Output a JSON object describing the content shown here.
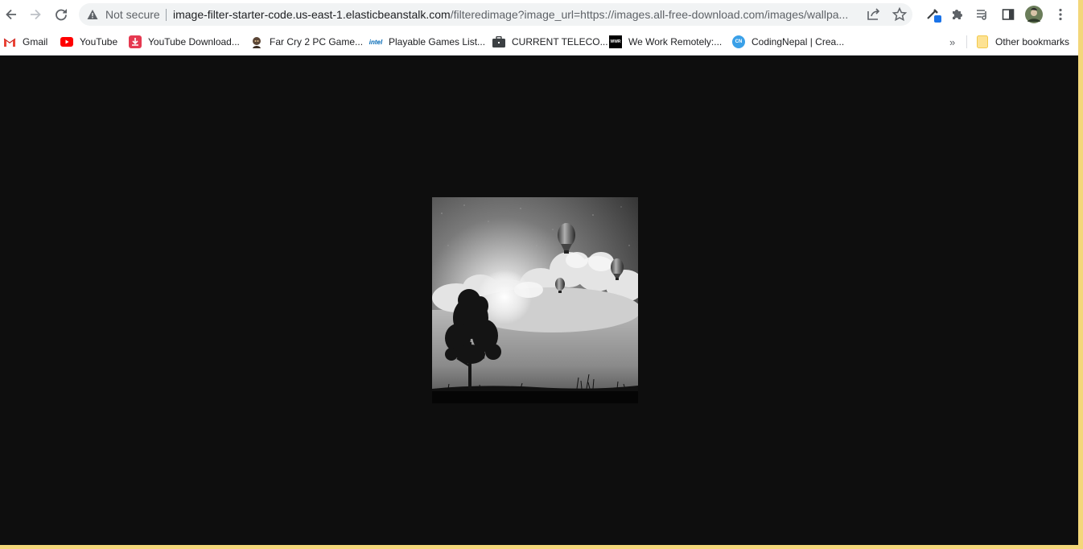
{
  "browser": {
    "security_label": "Not secure",
    "url_host": "image-filter-starter-code.us-east-1.elasticbeanstalk.com",
    "url_rest": "/filteredimage?image_url=https://images.all-free-download.com/images/wallpa...",
    "icons": {
      "back": "arrow-left-icon",
      "forward": "arrow-right-icon",
      "reload": "reload-icon",
      "warning": "warning-triangle-icon",
      "share": "share-icon",
      "bookmark": "star-icon",
      "eyedropper": "eyedropper-icon",
      "extensions": "puzzle-icon",
      "reading_list": "reading-list-icon",
      "side_panel": "side-panel-icon",
      "profile": "avatar",
      "menu": "kebab-menu-icon"
    }
  },
  "bookmarks": {
    "items": [
      {
        "label": "Gmail",
        "icon": "gmail-icon"
      },
      {
        "label": "YouTube",
        "icon": "youtube-icon"
      },
      {
        "label": "YouTube Download...",
        "icon": "download-icon"
      },
      {
        "label": "Far Cry 2 PC Game...",
        "icon": "game-icon"
      },
      {
        "label": "Playable Games List...",
        "icon": "intel-icon"
      },
      {
        "label": "CURRENT TELECO...",
        "icon": "briefcase-icon"
      },
      {
        "label": "We Work Remotely:...",
        "icon": "wwr-icon"
      },
      {
        "label": "CodingNepal | Crea...",
        "icon": "codingnepal-icon"
      }
    ],
    "overflow": "»",
    "other_bookmarks": "Other bookmarks"
  },
  "page": {
    "background": "#0e0e0e",
    "image_description_icon": "grayscale-image"
  },
  "favicon_text": {
    "intel": "intel",
    "wwr": "WWR",
    "cn": "CN"
  },
  "colors": {
    "youtube_red": "#ff0000",
    "accent_blue": "#1a73e8",
    "frame_yellow": "#f3d77a"
  }
}
